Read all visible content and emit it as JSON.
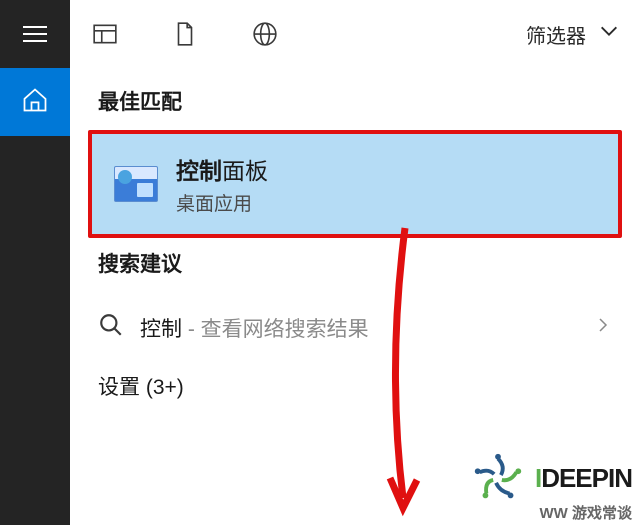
{
  "filter": {
    "label": "筛选器"
  },
  "best_match": {
    "header": "最佳匹配",
    "result": {
      "title_bold": "控制",
      "title_rest": "面板",
      "subtitle": "桌面应用"
    }
  },
  "search_suggestions": {
    "header": "搜索建议",
    "item": {
      "term": "控制",
      "separator": " - ",
      "hint": "查看网络搜索结果"
    }
  },
  "settings": {
    "label": "设置 (3+)"
  },
  "watermark": {
    "brand_i": "I",
    "brand_rest": "DEEPIN",
    "sub": "WW 游戏常谈"
  }
}
